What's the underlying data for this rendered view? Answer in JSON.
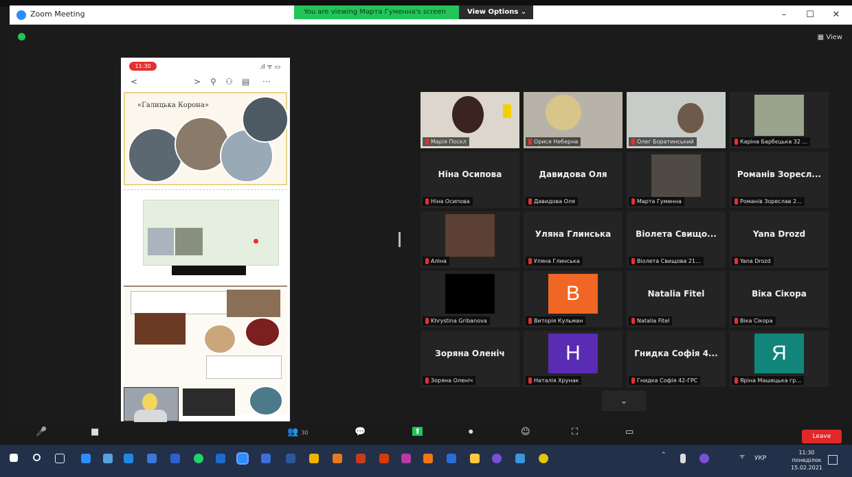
{
  "window": {
    "title": "Zoom Meeting",
    "share_banner": "You are viewing Марта Гуменна's screen",
    "view_options": "View Options ⌄",
    "minimize": "–",
    "maximize": "☐",
    "close": "✕"
  },
  "stage": {
    "view_label": "▦ View"
  },
  "shared_screen": {
    "phone_time": "11:30",
    "phone_status_icons": ".ıl ᯤ ▭",
    "toolbar": {
      "back": "<",
      "forward": ">",
      "search": "⚲",
      "add_person": "⚇",
      "slides": "▤",
      "more": "···"
    },
    "slide_title": "«Галицька Корона»"
  },
  "gallery": {
    "tiles": [
      {
        "name": "",
        "label": "Марія Поскл",
        "type": "video"
      },
      {
        "name": "",
        "label": "Орися Неберна",
        "type": "video"
      },
      {
        "name": "",
        "label": "Олег Боратинський",
        "type": "video"
      },
      {
        "name": "",
        "label": "Каріна Барбєцька 32 ...",
        "type": "video"
      },
      {
        "name": "Ніна Осипова",
        "label": "Ніна Осипова",
        "type": "name"
      },
      {
        "name": "Давидова Оля",
        "label": "Давидова Оля",
        "type": "name"
      },
      {
        "name": "",
        "label": "Марта Гуменна",
        "type": "video"
      },
      {
        "name": "Романів Зоресл...",
        "label": "Романів Зореслав 2...",
        "type": "name"
      },
      {
        "name": "",
        "label": "Аліна",
        "type": "video"
      },
      {
        "name": "Уляна Глинська",
        "label": "Уляна Глинська",
        "type": "name"
      },
      {
        "name": "Віолета Свищо...",
        "label": "Віолета Свищова 21...",
        "type": "name"
      },
      {
        "name": "Yana Drozd",
        "label": "Yana Drozd",
        "type": "name"
      },
      {
        "name": "",
        "label": "Khrystina Gribanova",
        "type": "video"
      },
      {
        "name": "В",
        "label": "Виторія Кульман",
        "type": "avatar"
      },
      {
        "name": "Natalia Fitel",
        "label": "Natalia Fitel",
        "type": "name"
      },
      {
        "name": "Віка Сікора",
        "label": "Віка Сікора",
        "type": "name"
      },
      {
        "name": "Зоряна Оленіч",
        "label": "Зоряна Оленіч",
        "type": "name"
      },
      {
        "name": "Н",
        "label": "Наталія Хрунак",
        "type": "avatar"
      },
      {
        "name": "Гнидка Софія 4...",
        "label": "Гнидка Софія 42-ГРС",
        "type": "name"
      },
      {
        "name": "Я",
        "label": "Яріна Машецька гр...",
        "type": "avatar"
      }
    ],
    "more_chevron": "⌄",
    "colors": {
      "active_speaker": "#d9e14a",
      "avatar_b": "#f06624",
      "avatar_n": "#5a2bb3",
      "avatar_ya": "#12857a"
    }
  },
  "controls": {
    "mute": "🎤",
    "video": "■",
    "participants": "👥",
    "participants_count": "30",
    "chat": "💬",
    "share": "⬆",
    "record": "⏺",
    "reactions": "☺",
    "apps": "⛶",
    "view": "▭",
    "leave": "Leave"
  },
  "taskbar": {
    "language": "УКР",
    "day": "понеділок",
    "time": "11:30",
    "date": "15.02.2021"
  }
}
